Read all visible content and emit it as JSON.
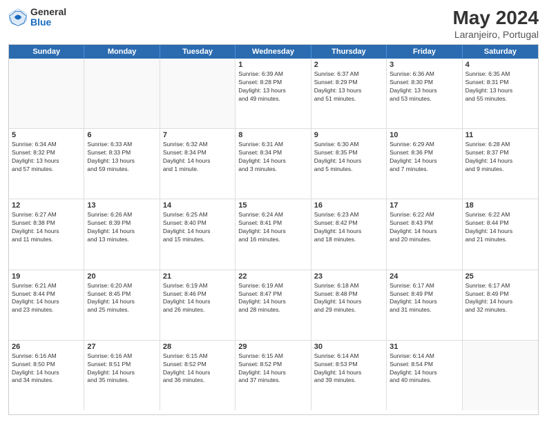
{
  "logo": {
    "general": "General",
    "blue": "Blue"
  },
  "title": "May 2024",
  "subtitle": "Laranjeiro, Portugal",
  "header": {
    "days": [
      "Sunday",
      "Monday",
      "Tuesday",
      "Wednesday",
      "Thursday",
      "Friday",
      "Saturday"
    ]
  },
  "weeks": [
    [
      {
        "day": "",
        "text": ""
      },
      {
        "day": "",
        "text": ""
      },
      {
        "day": "",
        "text": ""
      },
      {
        "day": "1",
        "text": "Sunrise: 6:39 AM\nSunset: 8:28 PM\nDaylight: 13 hours\nand 49 minutes."
      },
      {
        "day": "2",
        "text": "Sunrise: 6:37 AM\nSunset: 8:29 PM\nDaylight: 13 hours\nand 51 minutes."
      },
      {
        "day": "3",
        "text": "Sunrise: 6:36 AM\nSunset: 8:30 PM\nDaylight: 13 hours\nand 53 minutes."
      },
      {
        "day": "4",
        "text": "Sunrise: 6:35 AM\nSunset: 8:31 PM\nDaylight: 13 hours\nand 55 minutes."
      }
    ],
    [
      {
        "day": "5",
        "text": "Sunrise: 6:34 AM\nSunset: 8:32 PM\nDaylight: 13 hours\nand 57 minutes."
      },
      {
        "day": "6",
        "text": "Sunrise: 6:33 AM\nSunset: 8:33 PM\nDaylight: 13 hours\nand 59 minutes."
      },
      {
        "day": "7",
        "text": "Sunrise: 6:32 AM\nSunset: 8:34 PM\nDaylight: 14 hours\nand 1 minute."
      },
      {
        "day": "8",
        "text": "Sunrise: 6:31 AM\nSunset: 8:34 PM\nDaylight: 14 hours\nand 3 minutes."
      },
      {
        "day": "9",
        "text": "Sunrise: 6:30 AM\nSunset: 8:35 PM\nDaylight: 14 hours\nand 5 minutes."
      },
      {
        "day": "10",
        "text": "Sunrise: 6:29 AM\nSunset: 8:36 PM\nDaylight: 14 hours\nand 7 minutes."
      },
      {
        "day": "11",
        "text": "Sunrise: 6:28 AM\nSunset: 8:37 PM\nDaylight: 14 hours\nand 9 minutes."
      }
    ],
    [
      {
        "day": "12",
        "text": "Sunrise: 6:27 AM\nSunset: 8:38 PM\nDaylight: 14 hours\nand 11 minutes."
      },
      {
        "day": "13",
        "text": "Sunrise: 6:26 AM\nSunset: 8:39 PM\nDaylight: 14 hours\nand 13 minutes."
      },
      {
        "day": "14",
        "text": "Sunrise: 6:25 AM\nSunset: 8:40 PM\nDaylight: 14 hours\nand 15 minutes."
      },
      {
        "day": "15",
        "text": "Sunrise: 6:24 AM\nSunset: 8:41 PM\nDaylight: 14 hours\nand 16 minutes."
      },
      {
        "day": "16",
        "text": "Sunrise: 6:23 AM\nSunset: 8:42 PM\nDaylight: 14 hours\nand 18 minutes."
      },
      {
        "day": "17",
        "text": "Sunrise: 6:22 AM\nSunset: 8:43 PM\nDaylight: 14 hours\nand 20 minutes."
      },
      {
        "day": "18",
        "text": "Sunrise: 6:22 AM\nSunset: 8:44 PM\nDaylight: 14 hours\nand 21 minutes."
      }
    ],
    [
      {
        "day": "19",
        "text": "Sunrise: 6:21 AM\nSunset: 8:44 PM\nDaylight: 14 hours\nand 23 minutes."
      },
      {
        "day": "20",
        "text": "Sunrise: 6:20 AM\nSunset: 8:45 PM\nDaylight: 14 hours\nand 25 minutes."
      },
      {
        "day": "21",
        "text": "Sunrise: 6:19 AM\nSunset: 8:46 PM\nDaylight: 14 hours\nand 26 minutes."
      },
      {
        "day": "22",
        "text": "Sunrise: 6:19 AM\nSunset: 8:47 PM\nDaylight: 14 hours\nand 28 minutes."
      },
      {
        "day": "23",
        "text": "Sunrise: 6:18 AM\nSunset: 8:48 PM\nDaylight: 14 hours\nand 29 minutes."
      },
      {
        "day": "24",
        "text": "Sunrise: 6:17 AM\nSunset: 8:49 PM\nDaylight: 14 hours\nand 31 minutes."
      },
      {
        "day": "25",
        "text": "Sunrise: 6:17 AM\nSunset: 8:49 PM\nDaylight: 14 hours\nand 32 minutes."
      }
    ],
    [
      {
        "day": "26",
        "text": "Sunrise: 6:16 AM\nSunset: 8:50 PM\nDaylight: 14 hours\nand 34 minutes."
      },
      {
        "day": "27",
        "text": "Sunrise: 6:16 AM\nSunset: 8:51 PM\nDaylight: 14 hours\nand 35 minutes."
      },
      {
        "day": "28",
        "text": "Sunrise: 6:15 AM\nSunset: 8:52 PM\nDaylight: 14 hours\nand 36 minutes."
      },
      {
        "day": "29",
        "text": "Sunrise: 6:15 AM\nSunset: 8:52 PM\nDaylight: 14 hours\nand 37 minutes."
      },
      {
        "day": "30",
        "text": "Sunrise: 6:14 AM\nSunset: 8:53 PM\nDaylight: 14 hours\nand 39 minutes."
      },
      {
        "day": "31",
        "text": "Sunrise: 6:14 AM\nSunset: 8:54 PM\nDaylight: 14 hours\nand 40 minutes."
      },
      {
        "day": "",
        "text": ""
      }
    ]
  ]
}
